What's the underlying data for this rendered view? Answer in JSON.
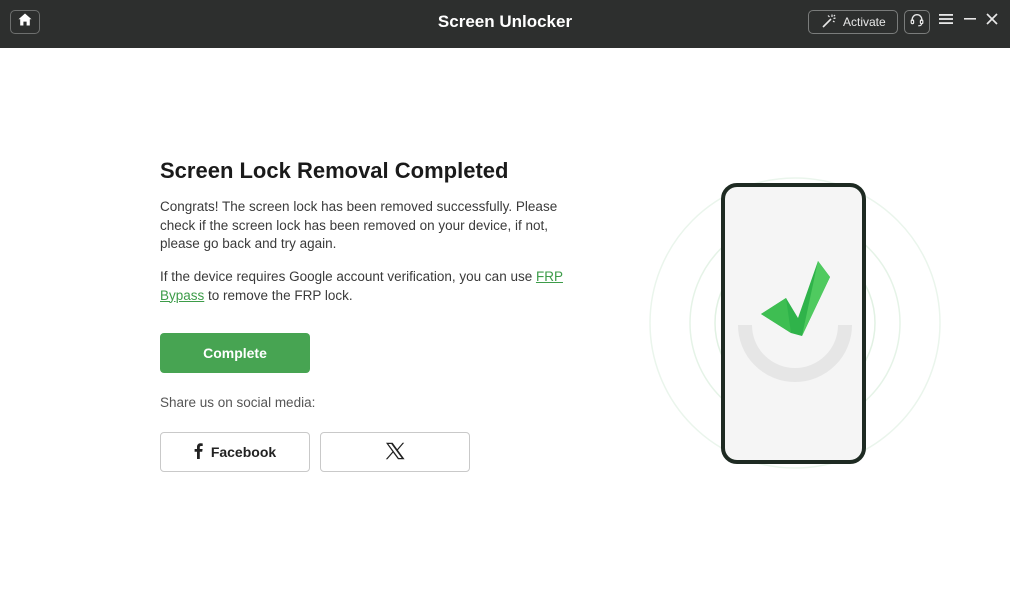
{
  "app": {
    "title": "Screen Unlocker"
  },
  "titlebar": {
    "activate_label": "Activate",
    "icons": [
      "home-icon",
      "wand-icon",
      "headset-icon",
      "menu-icon",
      "minimize-icon",
      "close-icon"
    ]
  },
  "main": {
    "heading": "Screen Lock Removal Completed",
    "paragraph1": "Congrats! The screen lock has been removed successfully. Please check if the screen lock has been removed on your device, if not, please go back and try again.",
    "paragraph2_prefix": "If the device requires Google account verification, you can use ",
    "frp_link": "FRP Bypass",
    "paragraph2_suffix": " to remove the FRP lock.",
    "complete_label": "Complete",
    "share_label": "Share us on social media:",
    "facebook_label": "Facebook"
  },
  "colors": {
    "titlebar_bg": "#2d2f2e",
    "accent_green": "#47a452",
    "link_green": "#3d9c49",
    "phone_frame": "#1e2a22",
    "check_green": "#2fb34a"
  }
}
